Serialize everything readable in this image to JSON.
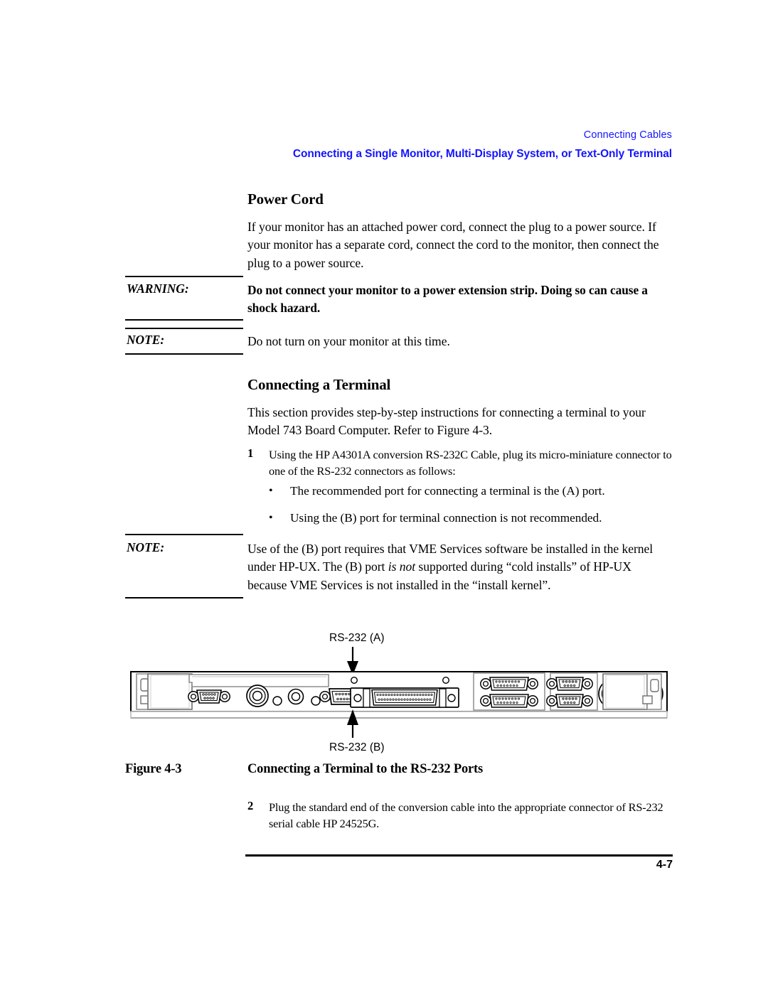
{
  "running_head": {
    "chapter": "Connecting Cables",
    "section": "Connecting a Single Monitor, Multi-Display System, or Text-Only Terminal",
    "color": "#1414ff"
  },
  "sections": {
    "power_cord": {
      "heading": "Power Cord",
      "paragraph": "If your monitor has an attached power cord, connect the plug to a power source. If your monitor has a separate cord, connect the cord to the monitor, then connect the plug to a power source."
    },
    "connecting_terminal": {
      "heading": "Connecting a Terminal",
      "paragraph": "This section provides step-by-step instructions for connecting a terminal to your Model 743 Board Computer. Refer to Figure 4-3."
    }
  },
  "admonitions": {
    "warning_1": {
      "label": "WARNING:",
      "text": "Do not connect your monitor to a power extension strip. Doing so can cause a shock hazard."
    },
    "note_1": {
      "label": "NOTE:",
      "text": "Do not turn on your monitor at this time."
    },
    "note_2": {
      "label": "NOTE:",
      "text_part_1": "Use of the (B) port requires that VME Services software be installed in the kernel under HP-UX. The (B) port ",
      "emphasis": "is not",
      "text_part_2": " supported during “cold installs” of HP-UX because VME Services is not installed in the “install kernel”."
    }
  },
  "steps": [
    {
      "number": "1",
      "text": "Using the HP A4301A conversion RS-232C Cable, plug its micro-miniature connector to one of the RS-232 connectors as follows:"
    },
    {
      "number": "2",
      "text": "Plug the standard end of the conversion cable into the appropriate connector of RS-232 serial cable HP 24525G."
    }
  ],
  "bullets": [
    {
      "marker": "•",
      "text": "The recommended port for connecting a terminal is the (A) port."
    },
    {
      "marker": "•",
      "text": "Using the (B) port for terminal connection is not recommended."
    }
  ],
  "figure": {
    "caption_number": "Figure 4-3",
    "caption_title": "Connecting a Terminal to the RS-232 Ports",
    "callout_top": "RS-232 (A)",
    "callout_bottom": "RS-232 (B)",
    "alt": "Rear panel of Model 743 Board Computer showing serial, parallel, SCSI, LAN and keyboard/mouse connectors"
  },
  "footer": {
    "page_number": "4-7"
  }
}
